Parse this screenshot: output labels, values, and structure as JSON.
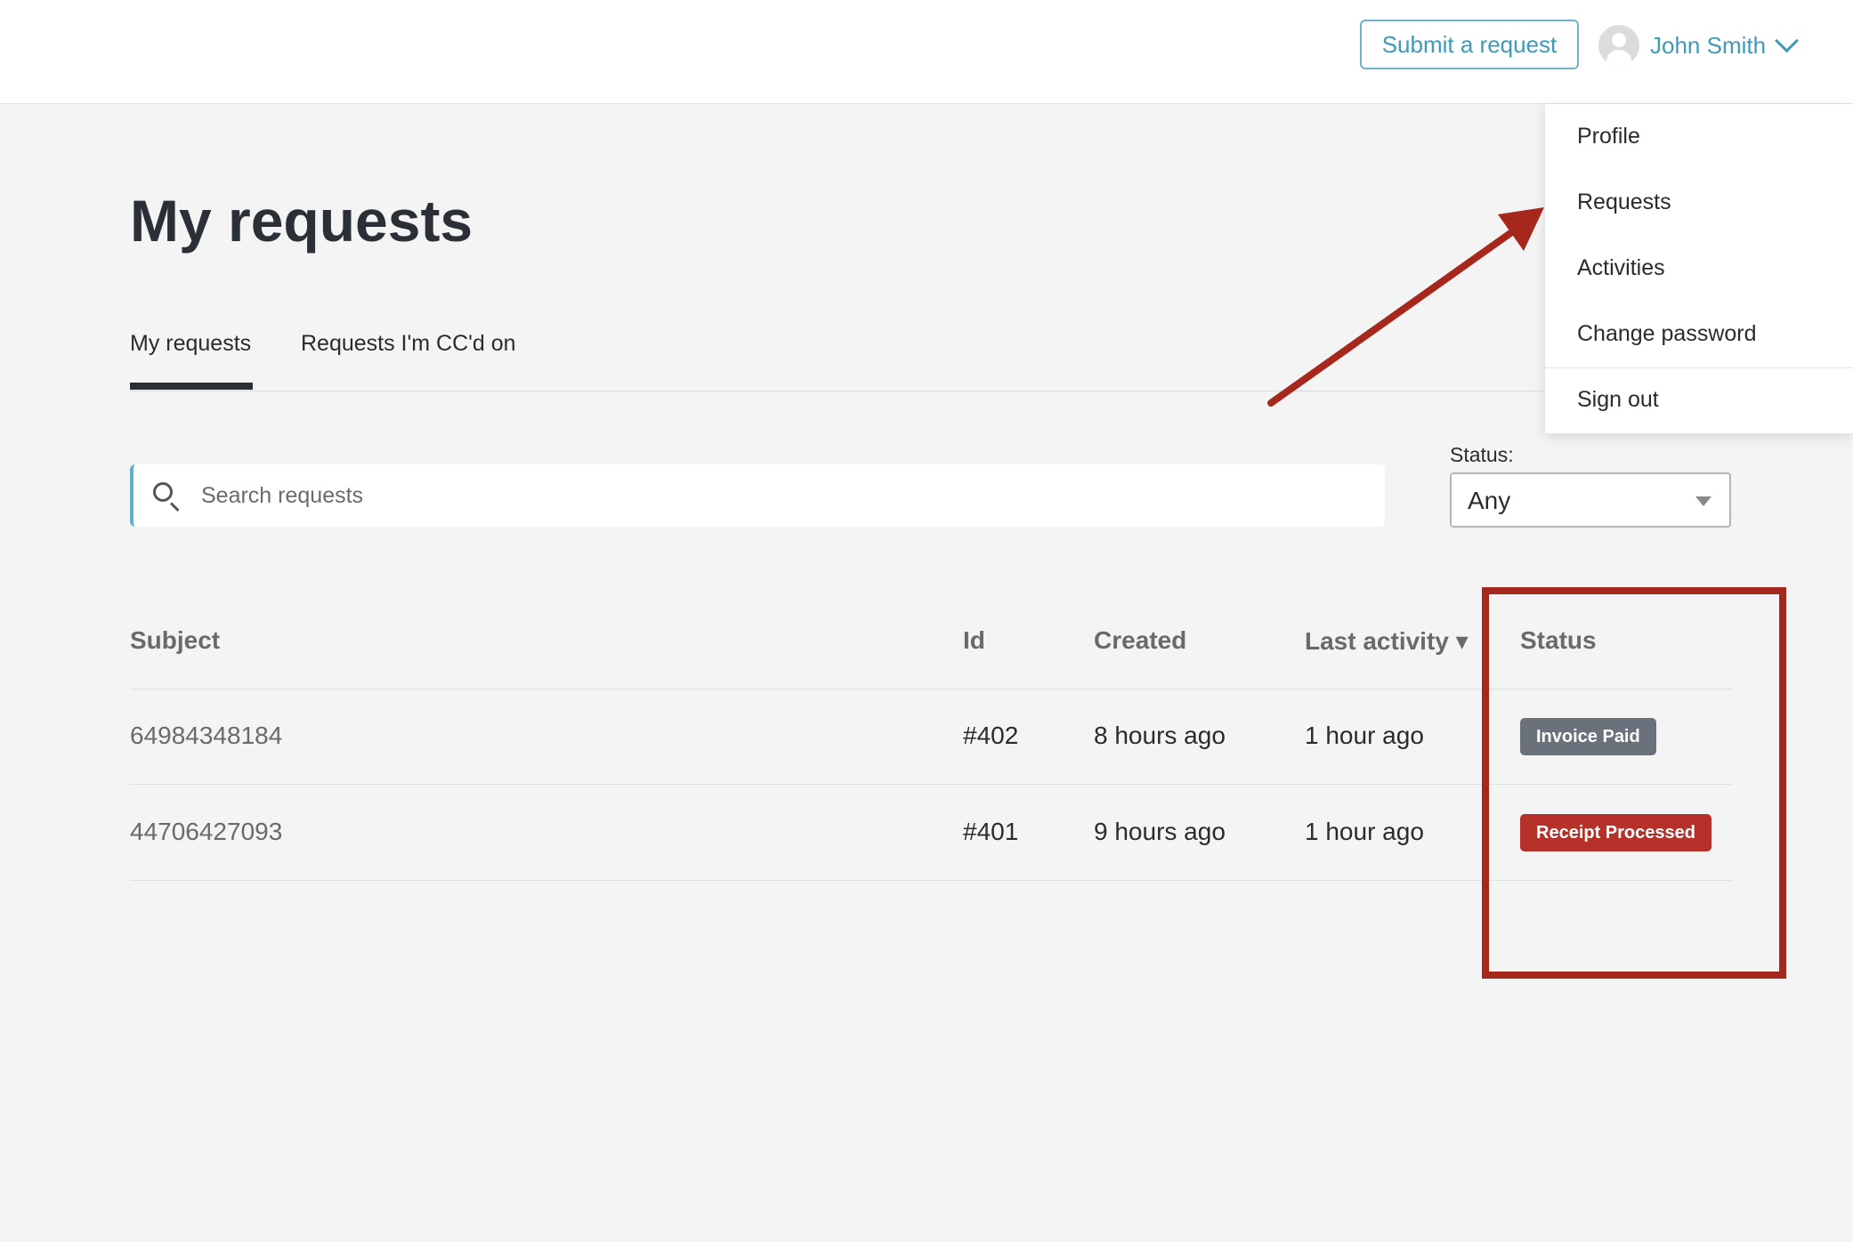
{
  "header": {
    "submit_button": "Submit a request",
    "user_name": "John Smith"
  },
  "user_dropdown": {
    "items": [
      "Profile",
      "Requests",
      "Activities",
      "Change password"
    ],
    "sign_out": "Sign out"
  },
  "page": {
    "title": "My requests"
  },
  "tabs": [
    {
      "label": "My requests",
      "active": true
    },
    {
      "label": "Requests I'm CC'd on",
      "active": false
    }
  ],
  "search": {
    "placeholder": "Search requests",
    "value": ""
  },
  "status_filter": {
    "label": "Status:",
    "value": "Any"
  },
  "table": {
    "columns": {
      "subject": "Subject",
      "id": "Id",
      "created": "Created",
      "last_activity": "Last activity ▾",
      "status": "Status"
    },
    "rows": [
      {
        "subject": "64984348184",
        "id": "#402",
        "created": "8 hours ago",
        "last_activity": "1 hour ago",
        "status": "Invoice Paid",
        "status_color": "#6b717a"
      },
      {
        "subject": "44706427093",
        "id": "#401",
        "created": "9 hours ago",
        "last_activity": "1 hour ago",
        "status": "Receipt Processed",
        "status_color": "#b5312a"
      }
    ]
  },
  "colors": {
    "accent": "#3f9ab8",
    "annotation": "#a6281c",
    "background": "#f4f4f4"
  }
}
